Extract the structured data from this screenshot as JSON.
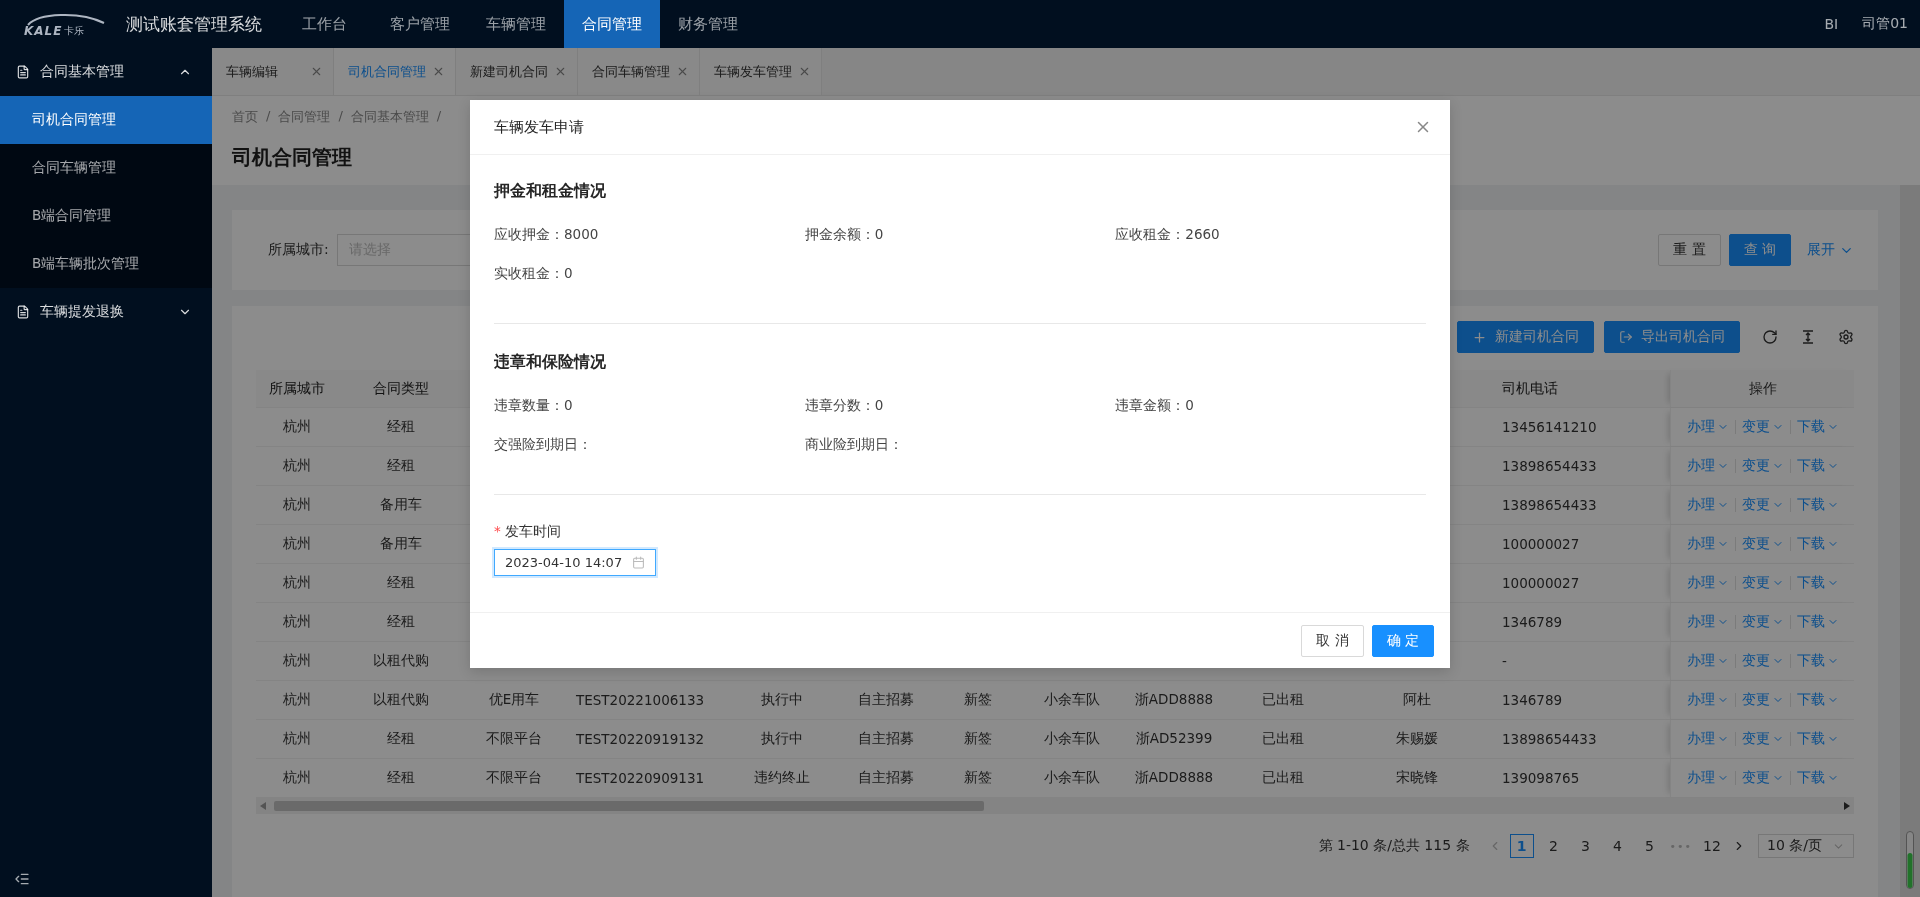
{
  "header": {
    "logo": {
      "text": "KALE",
      "sub": "卡乐"
    },
    "title": "测试账套管理系统",
    "nav": [
      {
        "label": "工作台",
        "selected": false
      },
      {
        "label": "客户管理",
        "selected": false
      },
      {
        "label": "车辆管理",
        "selected": false
      },
      {
        "label": "合同管理",
        "selected": true
      },
      {
        "label": "财务管理",
        "selected": false
      }
    ],
    "right": [
      "BI",
      "司管01"
    ]
  },
  "sidebar": {
    "groups": [
      {
        "label": "合同基本管理",
        "expanded": true,
        "children": [
          {
            "label": "司机合同管理",
            "selected": true
          },
          {
            "label": "合同车辆管理",
            "selected": false
          },
          {
            "label": "B端合同管理",
            "selected": false
          },
          {
            "label": "B端车辆批次管理",
            "selected": false
          }
        ]
      },
      {
        "label": "车辆提发退换",
        "expanded": false
      }
    ]
  },
  "tabs": [
    {
      "label": "车辆编辑",
      "selected": false
    },
    {
      "label": "司机合同管理",
      "selected": true
    },
    {
      "label": "新建司机合同",
      "selected": false
    },
    {
      "label": "合同车辆管理",
      "selected": false
    },
    {
      "label": "车辆发车管理",
      "selected": false
    }
  ],
  "breadcrumb": {
    "items": [
      "首页",
      "合同管理",
      "合同基本管理"
    ],
    "separator": "/"
  },
  "page_title": "司机合同管理",
  "search": {
    "fields": [
      {
        "label": "所属城市:",
        "placeholder": "请选择"
      }
    ],
    "buttons": [
      {
        "label": "重 置",
        "kind": "default"
      },
      {
        "label": "查 询",
        "kind": "primary"
      }
    ],
    "expand": "展开"
  },
  "toolbar": {
    "buttons": [
      {
        "label": "新建司机合同",
        "kind": "add"
      },
      {
        "label": "导出司机合同",
        "kind": "export"
      }
    ]
  },
  "table": {
    "columns": [
      "所属城市",
      "合同类型",
      "司机电话",
      "操作"
    ],
    "rows": [
      {
        "city": "杭州",
        "contract_type": "经租",
        "phone": "13456141210",
        "actions": [
          "办理",
          "变更",
          "下载"
        ]
      },
      {
        "city": "杭州",
        "contract_type": "经租",
        "phone": "13898654433",
        "actions": [
          "办理",
          "变更",
          "下载"
        ]
      },
      {
        "city": "杭州",
        "contract_type": "备用车",
        "phone": "13898654433",
        "actions": [
          "办理",
          "变更",
          "下载"
        ]
      },
      {
        "city": "杭州",
        "contract_type": "备用车",
        "phone": "100000027",
        "actions": [
          "办理",
          "变更",
          "下载"
        ]
      },
      {
        "city": "杭州",
        "contract_type": "经租",
        "phone": "100000027",
        "actions": [
          "办理",
          "变更",
          "下载"
        ]
      },
      {
        "city": "杭州",
        "contract_type": "经租",
        "phone": "1346789",
        "actions": [
          "办理",
          "变更",
          "下载"
        ]
      },
      {
        "city": "杭州",
        "contract_type": "以租代购",
        "phone": "-",
        "actions": [
          "办理",
          "变更",
          "下载"
        ]
      },
      {
        "city": "杭州",
        "contract_type": "以租代购",
        "column_3": "优E用车",
        "column_4": "TEST20221006133",
        "column_5": "执行中",
        "column_6": "自主招募",
        "column_7": "新签",
        "column_8": "小余车队",
        "column_9": "浙ADD8888",
        "column_10": "已出租",
        "column_11": "阿杜",
        "phone": "1346789",
        "actions": [
          "办理",
          "变更",
          "下载"
        ]
      },
      {
        "city": "杭州",
        "contract_type": "经租",
        "column_3": "不限平台",
        "column_4": "TEST20220919132",
        "column_5": "执行中",
        "column_6": "自主招募",
        "column_7": "新签",
        "column_8": "小余车队",
        "column_9": "浙AD52399",
        "column_10": "已出租",
        "column_11": "朱赐媛",
        "phone": "13898654433",
        "actions": [
          "办理",
          "变更",
          "下载"
        ]
      },
      {
        "city": "杭州",
        "contract_type": "经租",
        "column_3": "不限平台",
        "column_4": "TEST20220909131",
        "column_5": "违约终止",
        "column_6": "自主招募",
        "column_7": "新签",
        "column_8": "小余车队",
        "column_9": "浙ADD8888",
        "column_10": "已出租",
        "column_11": "宋晓锋",
        "phone": "139098765",
        "actions": [
          "办理",
          "变更",
          "下载"
        ]
      }
    ]
  },
  "pagination": {
    "summary": "第 1-10 条/总共 115 条",
    "pages": [
      {
        "label": "1",
        "kind": "page",
        "selected": true
      },
      {
        "label": "2",
        "kind": "page",
        "selected": false
      },
      {
        "label": "3",
        "kind": "page",
        "selected": false
      },
      {
        "label": "4",
        "kind": "page",
        "selected": false
      },
      {
        "label": "5",
        "kind": "page",
        "selected": false
      },
      {
        "label": "•••",
        "kind": "ellipsis"
      },
      {
        "label": "12",
        "kind": "page",
        "selected": false
      }
    ],
    "page_size": "10 条/页"
  },
  "modal": {
    "title": "车辆发车申请",
    "sections": [
      {
        "title": "押金和租金情况",
        "fields": [
          {
            "label": "应收押金：",
            "value": "8000"
          },
          {
            "label": "押金余额：",
            "value": "0"
          },
          {
            "label": "应收租金：",
            "value": "2660"
          },
          {
            "label": "实收租金：",
            "value": "0"
          }
        ]
      },
      {
        "title": "违章和保险情况",
        "fields": [
          {
            "label": "违章数量：",
            "value": "0"
          },
          {
            "label": "违章分数：",
            "value": "0"
          },
          {
            "label": "违章金额：",
            "value": "0"
          },
          {
            "label": "交强险到期日："
          },
          {
            "label": "商业险到期日："
          }
        ]
      }
    ],
    "form": {
      "required_mark": "*",
      "label": "发车时间",
      "value": "2023-04-10 14:07",
      "focused": true
    },
    "buttons": [
      {
        "label": "取 消",
        "kind": "default"
      },
      {
        "label": "确 定",
        "kind": "primary"
      }
    ]
  }
}
